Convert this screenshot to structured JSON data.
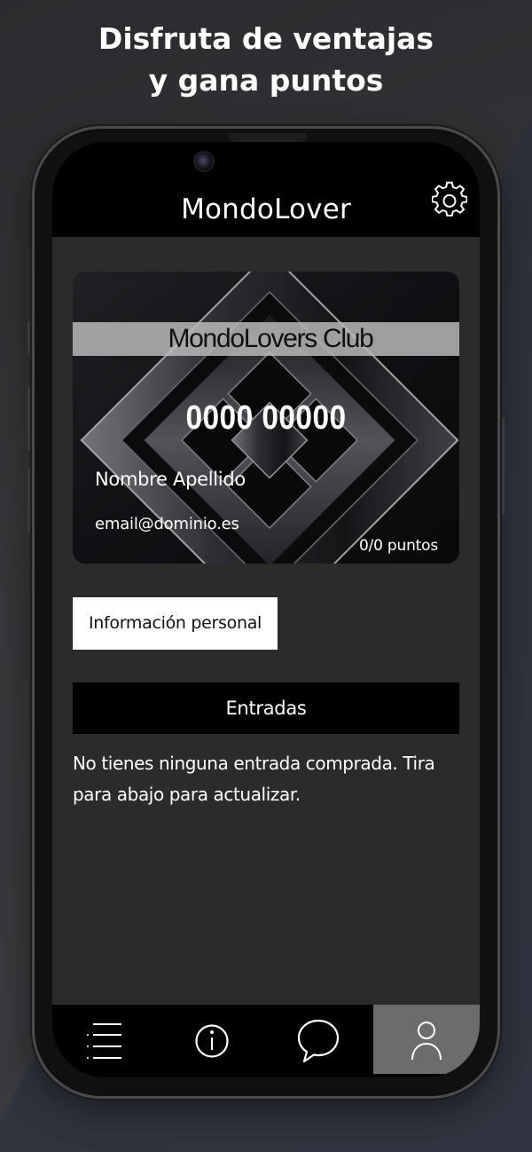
{
  "promo": {
    "line1": "Disfruta de ventajas",
    "line2": "y gana puntos"
  },
  "app": {
    "title": "MondoLover",
    "settings_icon": "gear-icon"
  },
  "card": {
    "club_name": "MondoLovers Club",
    "number": "0000 00000",
    "name": "Nombre Apellido",
    "email": "email@dominio.es",
    "points": "0/0 puntos"
  },
  "buttons": {
    "personal_info": "Información personal"
  },
  "entries": {
    "header": "Entradas",
    "empty_message": "No tienes ninguna entrada comprada. Tira para abajo para actualizar."
  },
  "tabbar": {
    "items": [
      {
        "icon": "list-icon",
        "active": false
      },
      {
        "icon": "info-icon",
        "active": false
      },
      {
        "icon": "chat-icon",
        "active": false
      },
      {
        "icon": "user-icon",
        "active": true
      }
    ]
  },
  "colors": {
    "background": "#2b2b2b",
    "tab_active": "#6c6c6c",
    "accent_white": "#ffffff"
  }
}
